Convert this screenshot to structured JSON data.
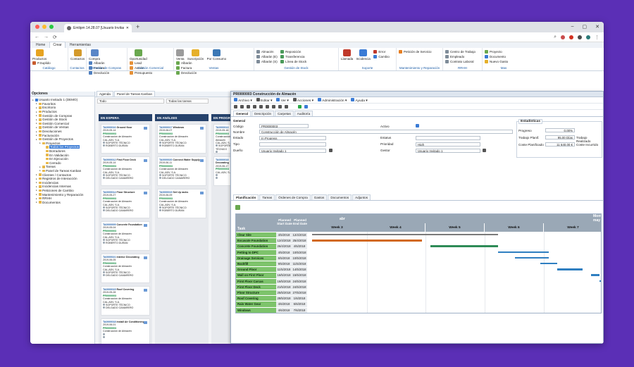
{
  "browser": {
    "tab_title": "Emlipm 14.28.07 [Usuario Invitad",
    "new_tab": "+",
    "controls": [
      "–",
      "▢",
      "✕"
    ],
    "back": "←",
    "forward": "→",
    "reload": "⟳",
    "menu": "⋮"
  },
  "menu": {
    "items": [
      "Home",
      "Crear",
      "Herramientas"
    ],
    "active": 1
  },
  "ribbon": {
    "catalogo": {
      "title": "Catálogo",
      "big": "Productos",
      "small": [
        "P.Suplido"
      ]
    },
    "contactos": {
      "title": "Contactos",
      "big": "Contactos"
    },
    "compras": {
      "title": "Gestión de Compras",
      "big": "Compra",
      "small": [
        "Albarán",
        "Factura",
        "Devolución"
      ]
    },
    "comercial": {
      "title": "Gestión Comercial",
      "big": "Oportunidad",
      "small": [
        "Lead",
        "Acción",
        "Presupuesto"
      ]
    },
    "ventas": {
      "title": "Ventas",
      "big": [
        "Venta",
        "Suscripción",
        "Por Consumo"
      ],
      "small": [
        "Albarán",
        "Factura",
        "Devolución"
      ]
    },
    "stock": {
      "title": "Gestión de Stock",
      "small": [
        "Almacén",
        "Albarán (E)",
        "Albarán (S)",
        "Reposición",
        "Transferencia",
        "Línea de Stock"
      ]
    },
    "soporte": {
      "title": "Soporte",
      "big": [
        "Llamada",
        "Incidencia"
      ],
      "small": [
        "Error",
        "Cambio"
      ]
    },
    "mant": {
      "title": "Mantenimiento y Reparación",
      "small": [
        "Petición de Servicio"
      ]
    },
    "rrhh": {
      "title": "RRHH",
      "small": [
        "Centro de Trabajo",
        "Empleado",
        "Contrato Laboral"
      ]
    },
    "mas": {
      "title": "Mas",
      "small": [
        "Proyecto",
        "Documento",
        "Nuevo Gasto"
      ]
    }
  },
  "sidebar": {
    "title": "Opciones",
    "items": [
      {
        "label": "Usuario Invitado 1 (DEMO)",
        "level": 0
      },
      {
        "label": "Favoritos",
        "level": 1
      },
      {
        "label": "Escritorio",
        "level": 1
      },
      {
        "label": "Productos",
        "level": 1
      },
      {
        "label": "Gestión de Compras",
        "level": 1
      },
      {
        "label": "Gestión de Stock",
        "level": 1
      },
      {
        "label": "Gestión Comercial",
        "level": 1
      },
      {
        "label": "Gestión de Ventas",
        "level": 1
      },
      {
        "label": "Devoluciones",
        "level": 1
      },
      {
        "label": "Facturación",
        "level": 1
      },
      {
        "label": "Gestión de Proyectos",
        "level": 1
      },
      {
        "label": "Proyectos",
        "level": 2
      },
      {
        "label": "Todos los Proyectos",
        "level": 3,
        "selected": true
      },
      {
        "label": "Borradores",
        "level": 3
      },
      {
        "label": "En Validación",
        "level": 3
      },
      {
        "label": "En Ejecución",
        "level": 3
      },
      {
        "label": "Cerrado",
        "level": 3
      },
      {
        "label": "Tareas",
        "level": 2
      },
      {
        "label": "Panel de Tareas Kanban",
        "level": 2
      },
      {
        "label": "Clientes / Contactos",
        "level": 1
      },
      {
        "label": "Registros de Interacción",
        "level": 1
      },
      {
        "label": "Incidencias",
        "level": 1
      },
      {
        "label": "Incidencias Internas",
        "level": 1
      },
      {
        "label": "Peticiones de Cambio",
        "level": 1
      },
      {
        "label": "Mantenimiento y Reparación",
        "level": 1
      },
      {
        "label": "RRHH",
        "level": 1
      },
      {
        "label": "Documentos",
        "level": 1
      }
    ]
  },
  "center": {
    "tabs": [
      "Agenda",
      "Panel de Tareas Kanban"
    ],
    "filter1": "Todo",
    "filter2": "Todas las tareas",
    "columns": [
      {
        "title": "EN ESPERA",
        "cards": [
          {
            "id": "TA0000016",
            "name": "Ground floor",
            "date": "2019-05-14",
            "project": "PR0000003",
            "desc": "Construcción de Almacén",
            "client": "CAL-ADV, S.A.",
            "dept": "SOPORTE TÉCNICO",
            "user": "ROBERTO DURAN"
          },
          {
            "id": "TA0000012",
            "name": "First Floor Deck",
            "date": "2019-05-14",
            "project": "PR0000003",
            "desc": "Construcción de Almacén",
            "client": "CAL-ADV, S.A.",
            "dept": "SOPORTE TÉCNICO",
            "user": "DELGADO CAMARERO"
          },
          {
            "id": "TA0000014",
            "name": "Floor Structure",
            "date": "2019-05-27",
            "project": "PR0000003",
            "desc": "Construcción de Almacén",
            "client": "CAL-ADV, S.A.",
            "dept": "SOPORTE TÉCNICO",
            "user": "DELGADO CAMARERO"
          },
          {
            "id": "TA0000009",
            "name": "Concrete Foundation",
            "date": "2019-05-04",
            "project": "PR0000003",
            "desc": "Construcción de Almacén",
            "client": "CAL-ADV, S.A.",
            "dept": "SOPORTE TÉCNICO",
            "user": "ROBERTO DURAN"
          },
          {
            "id": "TA0000021",
            "name": "Interior Decorating",
            "date": "2019-06-05",
            "project": "PR0000003",
            "desc": "Construcción de Almacén",
            "client": "CAL-ADV, S.A.",
            "dept": "SOPORTE TÉCNICO",
            "user": "DELGADO CAMARERO"
          },
          {
            "id": "TA0000015",
            "name": "Roof Covering",
            "date": "2019-05-28",
            "project": "PR0000003",
            "desc": "Construcción de Almacén",
            "client": "CAL-ADV, S.A.",
            "dept": "SOPORTE TÉCNICO",
            "user": "DELGADO CAMARERO"
          },
          {
            "id": "TA0000018",
            "name": "Install Air Conditioning",
            "date": "2019-06-01",
            "project": "PR0000003",
            "desc": "Construcción de Almacén",
            "client": "",
            "dept": "",
            "user": ""
          }
        ]
      },
      {
        "title": "EN ANÁLISIS",
        "cards": [
          {
            "id": "TA0000017",
            "name": "Windows",
            "date": "2019-06-07",
            "project": "PR0000003",
            "desc": "Construcción de Almacén",
            "client": "CAL-ADV, S.A.",
            "dept": "SOPORTE TÉCNICO",
            "user": "ROBERTO DURAN"
          },
          {
            "id": "TA0000020",
            "name": "Connect Water Supply",
            "date": "2019-06-11",
            "project": "PR0000003",
            "desc": "Construcción de Almacén",
            "client": "CAL-ADV, S.A.",
            "dept": "SOPORTE TÉCNICO",
            "user": "DELGADO CAMARERO"
          },
          {
            "id": "TA0000019",
            "name": "Set Up racks",
            "date": "2019-06-09",
            "project": "PR0000003",
            "desc": "Construcción de Almacén",
            "client": "CAL-ADV, S.A.",
            "dept": "SOPORTE TÉCNICO",
            "user": "ROBERTO DURAN"
          }
        ]
      },
      {
        "title": "EN PROGRESO",
        "cards": [
          {
            "id": "TA0000013",
            "name": "",
            "date": "2019-05-16",
            "project": "PR0000003",
            "desc": "Construcción de Almacén",
            "client": "CAL-ADV, S.A.",
            "dept": "SOPORTE TÉCNICO",
            "user": ""
          },
          {
            "id": "TA0000018",
            "name": "Decorating",
            "date": "2019-06-17",
            "project": "PR0000003",
            "desc": "",
            "client": "CAL-ADV, S.A.",
            "dept": "",
            "user": ""
          }
        ]
      }
    ]
  },
  "form": {
    "title": "PR0000003 Construcción de Almacén",
    "toolbar": [
      "Archivo",
      "Editar",
      "Ver",
      "Acciones",
      "Administración",
      "Ayuda"
    ],
    "tabs": [
      "General",
      "Descripción",
      "Carpetas",
      "Auditoría"
    ],
    "section": "General",
    "fields": {
      "codigo_label": "Código",
      "codigo": "PR0000003",
      "nombre_label": "Nombre",
      "nombre": "Construcción de Almacén",
      "estado_label": "Estado",
      "estado": "In Progress",
      "tipo_label": "Tipo",
      "dueno_label": "Dueño",
      "dueno": "Usuario Invitado 1",
      "activo_label": "Activo",
      "estatus_label": "Estatus",
      "prioridad_label": "Prioridad",
      "prioridad": "High",
      "gestor_label": "Gestor",
      "gestor": "Usuario Invitado 1"
    },
    "stats": {
      "title": "Estadísticas",
      "progreso_label": "Progreso",
      "progreso": "0.00%",
      "trabajo_label": "Trabajo Planif.",
      "trabajo": "95.00 Días",
      "trabajo_real_label": "Trabajo Realizado",
      "coste_label": "Coste Planificado",
      "coste": "11 640.00 €",
      "coste_inc_label": "Coste Incurrido"
    },
    "ptabs": [
      "Planificación",
      "Tareas",
      "Órdenes de Compra",
      "Gastos",
      "Documentos",
      "Adjuntos"
    ],
    "gantt": {
      "headers": {
        "task": "Task",
        "ps": "Planned Start Date",
        "pe": "Planned End Date",
        "month": "abr",
        "month2": "may",
        "month3": "Mont"
      },
      "weeks": [
        "Week 3",
        "Week 4",
        "Week 5",
        "Week 6",
        "Week 7"
      ],
      "rows": [
        {
          "task": "Clear Site",
          "start": "4/5/2018",
          "end": "12/4/2018"
        },
        {
          "task": "Excavate Foundation",
          "start": "12/4/2018",
          "end": "25/4/2018"
        },
        {
          "task": "Concrete Foundation",
          "start": "26/4/2018",
          "end": "4/5/2018"
        },
        {
          "task": "Fetting to DPC",
          "start": "4/5/2018",
          "end": "10/5/2018"
        },
        {
          "task": "Drainage Services",
          "start": "6/5/2018",
          "end": "10/5/2018"
        },
        {
          "task": "Backfill",
          "start": "9/5/2018",
          "end": "11/5/2018"
        },
        {
          "task": "Ground Floor",
          "start": "11/5/2018",
          "end": "14/5/2018"
        },
        {
          "task": "Wall on First Floor",
          "start": "16/5/2018",
          "end": "15/5/2018"
        },
        {
          "task": "First Floor Carcas",
          "start": "16/5/2018",
          "end": "24/5/2018"
        },
        {
          "task": "First Floor Deck",
          "start": "21/5/2018",
          "end": "24/5/2018"
        },
        {
          "task": "Floor Structure",
          "start": "25/5/2018",
          "end": "27/5/2018"
        },
        {
          "task": "Roof Covering",
          "start": "28/5/2018",
          "end": "1/6/2018"
        },
        {
          "task": "Rain Water Gear",
          "start": "4/6/2018",
          "end": "6/6/2018"
        },
        {
          "task": "Windows",
          "start": "4/6/2018",
          "end": "7/6/2018"
        }
      ]
    }
  }
}
